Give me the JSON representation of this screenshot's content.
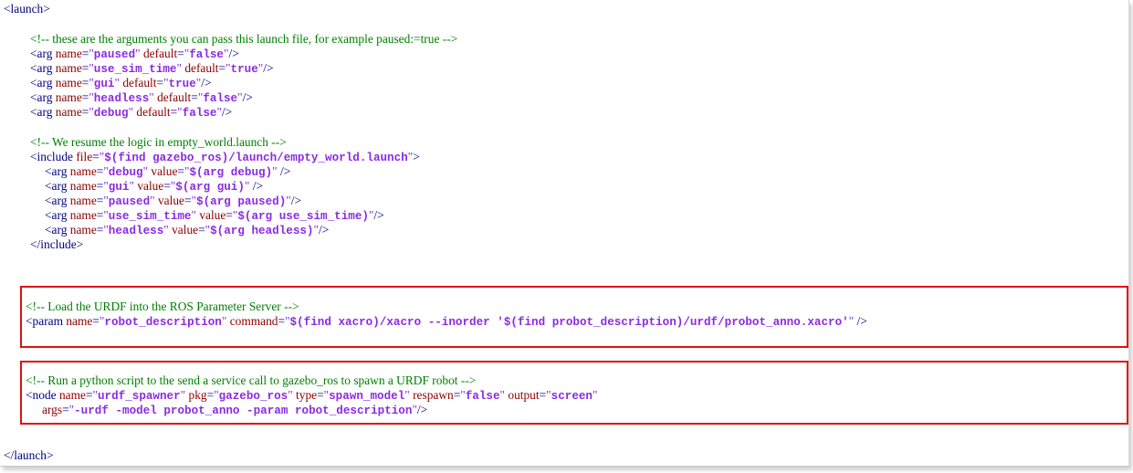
{
  "lines": [
    {
      "key": "l01",
      "parts": [
        {
          "t": "tag",
          "v": "<launch>"
        }
      ]
    },
    {
      "key": "l02",
      "parts": [
        {
          "t": "comment",
          "v": "<!-- these are the arguments you can pass this launch file, for example paused:=true -->"
        }
      ]
    },
    {
      "key": "l03",
      "parts": [
        {
          "t": "tag",
          "v": "<arg "
        },
        {
          "t": "attr",
          "v": "name"
        },
        {
          "t": "eq",
          "v": "="
        },
        {
          "t": "strq",
          "v": "\""
        },
        {
          "t": "str",
          "v": "paused"
        },
        {
          "t": "strq",
          "v": "\" "
        },
        {
          "t": "attr",
          "v": "default"
        },
        {
          "t": "eq",
          "v": "="
        },
        {
          "t": "strq",
          "v": "\""
        },
        {
          "t": "str",
          "v": "false"
        },
        {
          "t": "strq",
          "v": "\""
        },
        {
          "t": "tag",
          "v": "/>"
        }
      ]
    },
    {
      "key": "l04",
      "parts": [
        {
          "t": "tag",
          "v": "<arg "
        },
        {
          "t": "attr",
          "v": "name"
        },
        {
          "t": "eq",
          "v": "="
        },
        {
          "t": "strq",
          "v": "\""
        },
        {
          "t": "str",
          "v": "use_sim_time"
        },
        {
          "t": "strq",
          "v": "\" "
        },
        {
          "t": "attr",
          "v": "default"
        },
        {
          "t": "eq",
          "v": "="
        },
        {
          "t": "strq",
          "v": "\""
        },
        {
          "t": "str",
          "v": "true"
        },
        {
          "t": "strq",
          "v": "\""
        },
        {
          "t": "tag",
          "v": "/>"
        }
      ]
    },
    {
      "key": "l05",
      "parts": [
        {
          "t": "tag",
          "v": "<arg "
        },
        {
          "t": "attr",
          "v": "name"
        },
        {
          "t": "eq",
          "v": "="
        },
        {
          "t": "strq",
          "v": "\""
        },
        {
          "t": "str",
          "v": "gui"
        },
        {
          "t": "strq",
          "v": "\" "
        },
        {
          "t": "attr",
          "v": "default"
        },
        {
          "t": "eq",
          "v": "="
        },
        {
          "t": "strq",
          "v": "\""
        },
        {
          "t": "str",
          "v": "true"
        },
        {
          "t": "strq",
          "v": "\""
        },
        {
          "t": "tag",
          "v": "/>"
        }
      ]
    },
    {
      "key": "l06",
      "parts": [
        {
          "t": "tag",
          "v": "<arg "
        },
        {
          "t": "attr",
          "v": "name"
        },
        {
          "t": "eq",
          "v": "="
        },
        {
          "t": "strq",
          "v": "\""
        },
        {
          "t": "str",
          "v": "headless"
        },
        {
          "t": "strq",
          "v": "\" "
        },
        {
          "t": "attr",
          "v": "default"
        },
        {
          "t": "eq",
          "v": "="
        },
        {
          "t": "strq",
          "v": "\""
        },
        {
          "t": "str",
          "v": "false"
        },
        {
          "t": "strq",
          "v": "\""
        },
        {
          "t": "tag",
          "v": "/>"
        }
      ]
    },
    {
      "key": "l07",
      "parts": [
        {
          "t": "tag",
          "v": "<arg "
        },
        {
          "t": "attr",
          "v": "name"
        },
        {
          "t": "eq",
          "v": "="
        },
        {
          "t": "strq",
          "v": "\""
        },
        {
          "t": "str",
          "v": "debug"
        },
        {
          "t": "strq",
          "v": "\" "
        },
        {
          "t": "attr",
          "v": "default"
        },
        {
          "t": "eq",
          "v": "="
        },
        {
          "t": "strq",
          "v": "\""
        },
        {
          "t": "str",
          "v": "false"
        },
        {
          "t": "strq",
          "v": "\""
        },
        {
          "t": "tag",
          "v": "/>"
        }
      ]
    },
    {
      "key": "l08",
      "parts": [
        {
          "t": "comment",
          "v": "<!-- We resume the logic in empty_world.launch -->"
        }
      ]
    },
    {
      "key": "l09",
      "parts": [
        {
          "t": "tag",
          "v": "<include "
        },
        {
          "t": "attr",
          "v": "file"
        },
        {
          "t": "eq",
          "v": "="
        },
        {
          "t": "strq",
          "v": "\""
        },
        {
          "t": "str",
          "v": "$(find gazebo_ros)/launch/empty_world.launch"
        },
        {
          "t": "strq",
          "v": "\""
        },
        {
          "t": "tag",
          "v": ">"
        }
      ]
    },
    {
      "key": "l10",
      "parts": [
        {
          "t": "tag",
          "v": "<arg "
        },
        {
          "t": "attr",
          "v": "name"
        },
        {
          "t": "eq",
          "v": "="
        },
        {
          "t": "strq",
          "v": "\""
        },
        {
          "t": "str",
          "v": "debug"
        },
        {
          "t": "strq",
          "v": "\" "
        },
        {
          "t": "attr",
          "v": "value"
        },
        {
          "t": "eq",
          "v": "="
        },
        {
          "t": "strq",
          "v": "\""
        },
        {
          "t": "str",
          "v": "$(arg debug)"
        },
        {
          "t": "strq",
          "v": "\" "
        },
        {
          "t": "tag",
          "v": "/>"
        }
      ]
    },
    {
      "key": "l11",
      "parts": [
        {
          "t": "tag",
          "v": "<arg "
        },
        {
          "t": "attr",
          "v": "name"
        },
        {
          "t": "eq",
          "v": "="
        },
        {
          "t": "strq",
          "v": "\""
        },
        {
          "t": "str",
          "v": "gui"
        },
        {
          "t": "strq",
          "v": "\" "
        },
        {
          "t": "attr",
          "v": "value"
        },
        {
          "t": "eq",
          "v": "="
        },
        {
          "t": "strq",
          "v": "\""
        },
        {
          "t": "str",
          "v": "$(arg gui)"
        },
        {
          "t": "strq",
          "v": "\" "
        },
        {
          "t": "tag",
          "v": "/>"
        }
      ]
    },
    {
      "key": "l12",
      "parts": [
        {
          "t": "tag",
          "v": "<arg "
        },
        {
          "t": "attr",
          "v": "name"
        },
        {
          "t": "eq",
          "v": "="
        },
        {
          "t": "strq",
          "v": "\""
        },
        {
          "t": "str",
          "v": "paused"
        },
        {
          "t": "strq",
          "v": "\" "
        },
        {
          "t": "attr",
          "v": "value"
        },
        {
          "t": "eq",
          "v": "="
        },
        {
          "t": "strq",
          "v": "\""
        },
        {
          "t": "str",
          "v": "$(arg paused)"
        },
        {
          "t": "strq",
          "v": "\""
        },
        {
          "t": "tag",
          "v": "/>"
        }
      ]
    },
    {
      "key": "l13",
      "parts": [
        {
          "t": "tag",
          "v": "<arg "
        },
        {
          "t": "attr",
          "v": "name"
        },
        {
          "t": "eq",
          "v": "="
        },
        {
          "t": "strq",
          "v": "\""
        },
        {
          "t": "str",
          "v": "use_sim_time"
        },
        {
          "t": "strq",
          "v": "\" "
        },
        {
          "t": "attr",
          "v": "value"
        },
        {
          "t": "eq",
          "v": "="
        },
        {
          "t": "strq",
          "v": "\""
        },
        {
          "t": "str",
          "v": "$(arg use_sim_time)"
        },
        {
          "t": "strq",
          "v": "\""
        },
        {
          "t": "tag",
          "v": "/>"
        }
      ]
    },
    {
      "key": "l14",
      "parts": [
        {
          "t": "tag",
          "v": "<arg "
        },
        {
          "t": "attr",
          "v": "name"
        },
        {
          "t": "eq",
          "v": "="
        },
        {
          "t": "strq",
          "v": "\""
        },
        {
          "t": "str",
          "v": "headless"
        },
        {
          "t": "strq",
          "v": "\" "
        },
        {
          "t": "attr",
          "v": "value"
        },
        {
          "t": "eq",
          "v": "="
        },
        {
          "t": "strq",
          "v": "\""
        },
        {
          "t": "str",
          "v": "$(arg headless)"
        },
        {
          "t": "strq",
          "v": "\""
        },
        {
          "t": "tag",
          "v": "/>"
        }
      ]
    },
    {
      "key": "l15",
      "parts": [
        {
          "t": "tag",
          "v": "</include>"
        }
      ]
    },
    {
      "key": "l16",
      "parts": [
        {
          "t": "comment",
          "v": "<!-- Load the URDF into the ROS Parameter Server -->"
        }
      ]
    },
    {
      "key": "l17",
      "parts": [
        {
          "t": "tag",
          "v": "<param "
        },
        {
          "t": "attr",
          "v": "name"
        },
        {
          "t": "eq",
          "v": "="
        },
        {
          "t": "strq",
          "v": "\""
        },
        {
          "t": "str",
          "v": "robot_description"
        },
        {
          "t": "strq",
          "v": "\" "
        },
        {
          "t": "attr",
          "v": "command"
        },
        {
          "t": "eq",
          "v": "="
        },
        {
          "t": "strq",
          "v": "\""
        },
        {
          "t": "str",
          "v": "$(find xacro)/xacro --inorder '$(find probot_description)/urdf/probot_anno.xacro'"
        },
        {
          "t": "strq",
          "v": "\" "
        },
        {
          "t": "tag",
          "v": "/>"
        }
      ]
    },
    {
      "key": "l18",
      "parts": [
        {
          "t": "comment",
          "v": "<!-- Run a python script to the send a service call to gazebo_ros to spawn a URDF robot -->"
        }
      ]
    },
    {
      "key": "l19",
      "parts": [
        {
          "t": "tag",
          "v": "<node "
        },
        {
          "t": "attr",
          "v": "name"
        },
        {
          "t": "eq",
          "v": "="
        },
        {
          "t": "strq",
          "v": "\""
        },
        {
          "t": "str",
          "v": "urdf_spawner"
        },
        {
          "t": "strq",
          "v": "\" "
        },
        {
          "t": "attr",
          "v": "pkg"
        },
        {
          "t": "eq",
          "v": "="
        },
        {
          "t": "strq",
          "v": "\""
        },
        {
          "t": "str",
          "v": "gazebo_ros"
        },
        {
          "t": "strq",
          "v": "\" "
        },
        {
          "t": "attr",
          "v": "type"
        },
        {
          "t": "eq",
          "v": "="
        },
        {
          "t": "strq",
          "v": "\""
        },
        {
          "t": "str",
          "v": "spawn_model"
        },
        {
          "t": "strq",
          "v": "\" "
        },
        {
          "t": "attr",
          "v": "respawn"
        },
        {
          "t": "eq",
          "v": "="
        },
        {
          "t": "strq",
          "v": "\""
        },
        {
          "t": "str",
          "v": "false"
        },
        {
          "t": "strq",
          "v": "\" "
        },
        {
          "t": "attr",
          "v": "output"
        },
        {
          "t": "eq",
          "v": "="
        },
        {
          "t": "strq",
          "v": "\""
        },
        {
          "t": "str",
          "v": "screen"
        },
        {
          "t": "strq",
          "v": "\""
        }
      ]
    },
    {
      "key": "l20",
      "parts": [
        {
          "t": "attr",
          "v": "args"
        },
        {
          "t": "eq",
          "v": "="
        },
        {
          "t": "strq",
          "v": "\""
        },
        {
          "t": "str",
          "v": "-urdf -model probot_anno -param robot_description"
        },
        {
          "t": "strq",
          "v": "\""
        },
        {
          "t": "tag",
          "v": "/>"
        }
      ]
    },
    {
      "key": "l21",
      "parts": [
        {
          "t": "tag",
          "v": "</launch>"
        }
      ]
    }
  ],
  "colors": {
    "tag": "#000080",
    "attribute": "#8b0000",
    "string": "#8a2be2",
    "comment": "#008000",
    "highlight": "#e01010"
  }
}
